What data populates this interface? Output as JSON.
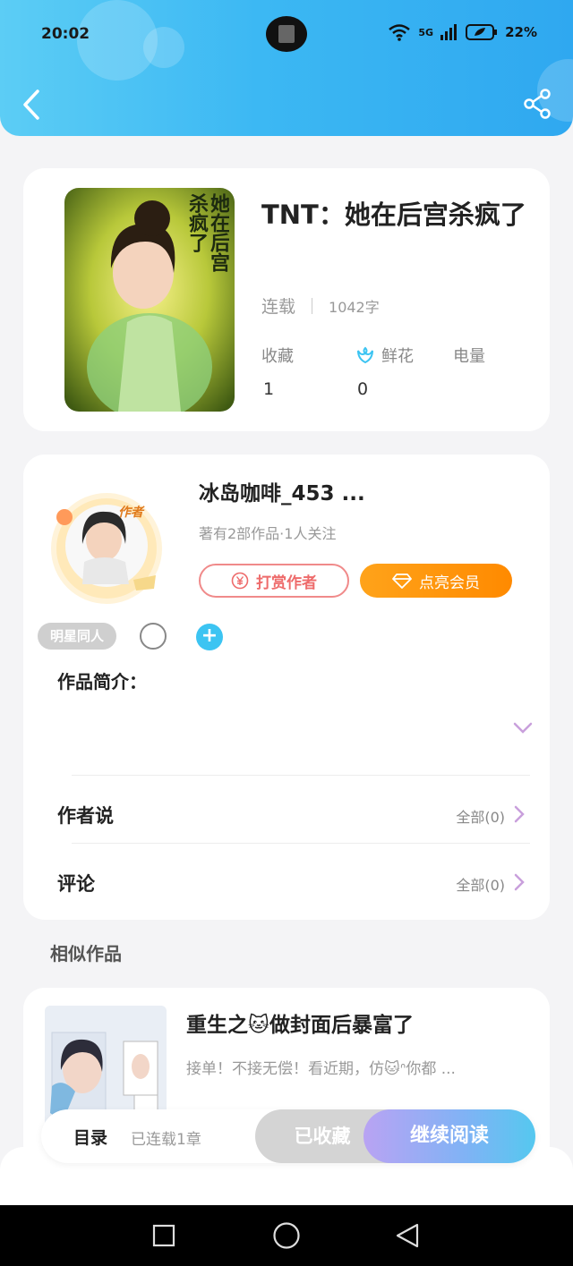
{
  "status_bar": {
    "time": "20:02",
    "signal": "5G",
    "battery": "22%"
  },
  "book": {
    "title": "TNT：她在后宫杀疯了",
    "cover_text": "她在后宫杀疯了",
    "status": "连载",
    "word_count": "1042字",
    "stats": [
      {
        "label": "收藏",
        "value": "1"
      },
      {
        "label": "鲜花",
        "value": "0"
      },
      {
        "label": "电量",
        "value": ""
      }
    ]
  },
  "author": {
    "badge": "作者",
    "name": "冰岛咖啡_453 ...",
    "summary": "著有2部作品·1人关注",
    "tip_label": "打赏作者",
    "vip_label": "点亮会员",
    "tag": "明星同人",
    "plus": "+"
  },
  "intro": {
    "label": "作品简介："
  },
  "author_says": {
    "label": "作者说",
    "count_label": "全部(0)"
  },
  "comments": {
    "label": "评论",
    "count_label": "全部(0)"
  },
  "similar": {
    "section_title": "相似作品",
    "items": [
      {
        "title": "重生之🐱做封面后暴富了",
        "desc": "接单！不接无偿！看近期，仿🐱ᐢ你都 ..."
      }
    ]
  },
  "bottom_bar": {
    "toc_label": "目录",
    "serial_label": "已连载1章",
    "collected_label": "已收藏",
    "read_label": "继续阅读"
  },
  "colors": {
    "header": "#3cb8f3",
    "vip": "#ff9a0a",
    "tip": "#ee6b6b",
    "accent": "#3cc4f2"
  }
}
